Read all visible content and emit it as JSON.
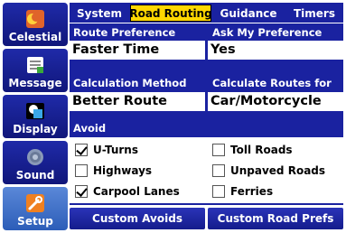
{
  "sidebar": {
    "items": [
      {
        "label": "Celestial",
        "icon": "celestial-icon",
        "active": false
      },
      {
        "label": "Message",
        "icon": "message-icon",
        "active": false
      },
      {
        "label": "Display",
        "icon": "display-icon",
        "active": false
      },
      {
        "label": "Sound",
        "icon": "sound-icon",
        "active": false
      },
      {
        "label": "Setup",
        "icon": "setup-icon",
        "active": true
      }
    ]
  },
  "tabs": [
    {
      "label": "System",
      "active": false
    },
    {
      "label": "Road Routing",
      "active": true
    },
    {
      "label": "Guidance",
      "active": false
    },
    {
      "label": "Timers",
      "active": false
    }
  ],
  "fields": {
    "route_preference": {
      "label": "Route Preference",
      "value": "Faster Time"
    },
    "ask_my_preference": {
      "label": "Ask My Preference",
      "value": "Yes"
    },
    "calculation_method": {
      "label": "Calculation Method",
      "value": "Better Route"
    },
    "calculate_routes_for": {
      "label": "Calculate Routes for",
      "value": "Car/Motorcycle"
    }
  },
  "avoid": {
    "header": "Avoid",
    "items": [
      {
        "label": "U-Turns",
        "checked": true
      },
      {
        "label": "Toll Roads",
        "checked": false
      },
      {
        "label": "Highways",
        "checked": false
      },
      {
        "label": "Unpaved Roads",
        "checked": false
      },
      {
        "label": "Carpool Lanes",
        "checked": true
      },
      {
        "label": "Ferries",
        "checked": false
      }
    ]
  },
  "buttons": {
    "custom_avoids": "Custom Avoids",
    "custom_road_prefs": "Custom Road Prefs"
  },
  "colors": {
    "panel_blue": "#1a22a0",
    "active_tab": "#ffd700",
    "sidebar_active": "#3a6cc4"
  }
}
